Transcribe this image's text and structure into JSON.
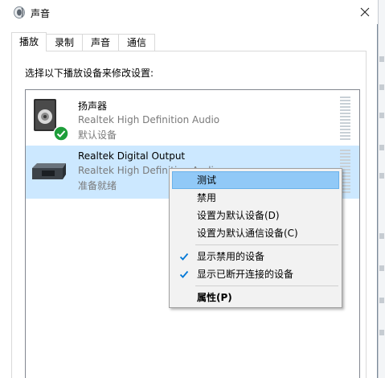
{
  "window": {
    "title": "声音",
    "close_glyph": "✕"
  },
  "tabs": [
    {
      "label": "播放",
      "active": true
    },
    {
      "label": "录制",
      "active": false
    },
    {
      "label": "声音",
      "active": false
    },
    {
      "label": "通信",
      "active": false
    }
  ],
  "instruction": "选择以下播放设备来修改设置:",
  "devices": [
    {
      "name": "扬声器",
      "driver": "Realtek High Definition Audio",
      "status": "默认设备",
      "icon": "speaker-icon",
      "badge": "default-check-icon",
      "selected": false
    },
    {
      "name": "Realtek Digital Output",
      "driver": "Realtek High Definition Audio",
      "status": "准备就绪",
      "icon": "digital-output-icon",
      "selected": true
    }
  ],
  "context_menu": {
    "items": [
      {
        "label": "测试",
        "highlighted": true
      },
      {
        "label": "禁用"
      },
      {
        "label": "设置为默认设备(D)"
      },
      {
        "label": "设置为默认通信设备(C)"
      },
      {
        "label": "显示禁用的设备",
        "checked": true
      },
      {
        "label": "显示已断开连接的设备",
        "checked": true
      },
      {
        "label": "属性(P)",
        "bold": true
      }
    ]
  },
  "colors": {
    "selection": "#cce8ff",
    "menu_highlight": "#91c9f7",
    "check": "#0078d7",
    "default_badge": "#1e9e3a"
  }
}
